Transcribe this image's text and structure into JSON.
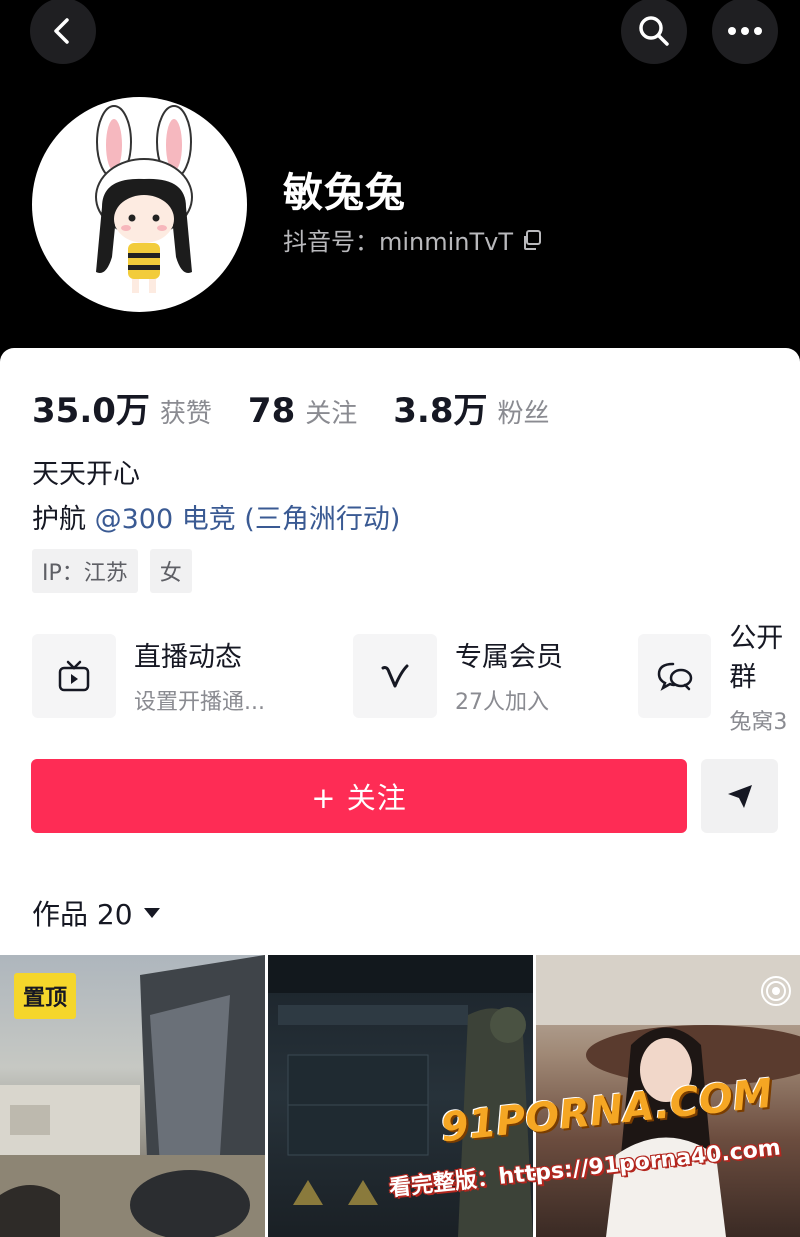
{
  "header": {
    "back_icon": "chevron-left-icon",
    "search_icon": "search-icon",
    "more_icon": "more-horizontal-icon"
  },
  "profile": {
    "nickname": "敏兔兔",
    "douyin_id": "抖音号：minminTvT",
    "copy_icon": "copy-icon"
  },
  "stats": [
    {
      "value": "35.0万",
      "label": "获赞"
    },
    {
      "value": "78",
      "label": "关注"
    },
    {
      "value": "3.8万",
      "label": "粉丝"
    }
  ],
  "bio": {
    "line1": "天天开心",
    "line2_prefix": "护航 ",
    "line2_mention": "@300 电竞 (三角洲行动)"
  },
  "tags": [
    "IP：江苏",
    "女"
  ],
  "features": [
    {
      "title": "直播动态",
      "subtitle": "设置开播通...",
      "icon": "tv-icon"
    },
    {
      "title": "专属会员",
      "subtitle": "27人加入",
      "icon": "v-icon"
    },
    {
      "title": "公开群",
      "subtitle": "兔窝3",
      "icon": "chat-bubbles-icon"
    }
  ],
  "actions": {
    "follow_label": "+ 关注",
    "share_icon": "send-icon"
  },
  "works": {
    "tab_label": "作品 20",
    "pin_label": "置顶"
  },
  "watermark": {
    "line1": "91PORNA.COM",
    "line2": "看完整版：https://91porna40.com"
  },
  "colors": {
    "accent": "#fe2c55",
    "mention": "#3a5a93",
    "pin": "#f5d62b"
  }
}
